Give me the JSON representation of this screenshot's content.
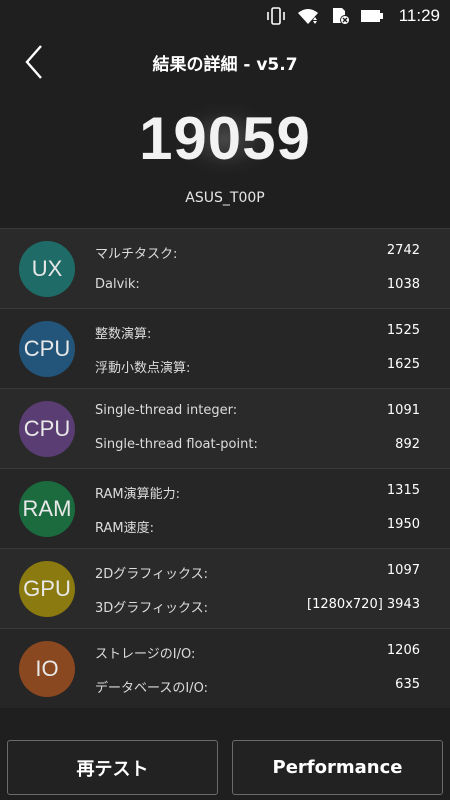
{
  "status_bar": {
    "time": "11:29",
    "icons": [
      "vibrate-icon",
      "wifi-icon",
      "sd-card-icon",
      "battery-icon"
    ]
  },
  "header": {
    "title": "結果の詳細 - v5.7",
    "back_icon": "chevron-left-icon"
  },
  "score": {
    "total": "19059",
    "device": "ASUS_T00P"
  },
  "categories": [
    {
      "badge": "UX",
      "color": "#1f6b67",
      "metrics": [
        {
          "label": "マルチタスク:",
          "value": "2742"
        },
        {
          "label": "Dalvik:",
          "value": "1038"
        }
      ]
    },
    {
      "badge": "CPU",
      "color": "#23557a",
      "metrics": [
        {
          "label": "整数演算:",
          "value": "1525"
        },
        {
          "label": "浮動小数点演算:",
          "value": "1625"
        }
      ]
    },
    {
      "badge": "CPU",
      "color": "#5a3d72",
      "metrics": [
        {
          "label": "Single-thread integer:",
          "value": "1091"
        },
        {
          "label": "Single-thread float-point:",
          "value": "892"
        }
      ]
    },
    {
      "badge": "RAM",
      "color": "#1c6b3f",
      "metrics": [
        {
          "label": "RAM演算能力:",
          "value": "1315"
        },
        {
          "label": "RAM速度:",
          "value": "1950"
        }
      ]
    },
    {
      "badge": "GPU",
      "color": "#8a7a10",
      "metrics": [
        {
          "label": "2Dグラフィックス:",
          "value": "1097"
        },
        {
          "label": "3Dグラフィックス:",
          "value": "[1280x720] 3943"
        }
      ]
    },
    {
      "badge": "IO",
      "color": "#8a4820",
      "metrics": [
        {
          "label": "ストレージのI/O:",
          "value": "1206"
        },
        {
          "label": "データベースのI/O:",
          "value": "635"
        }
      ]
    }
  ],
  "buttons": {
    "retest": "再テスト",
    "performance": "Performance"
  }
}
